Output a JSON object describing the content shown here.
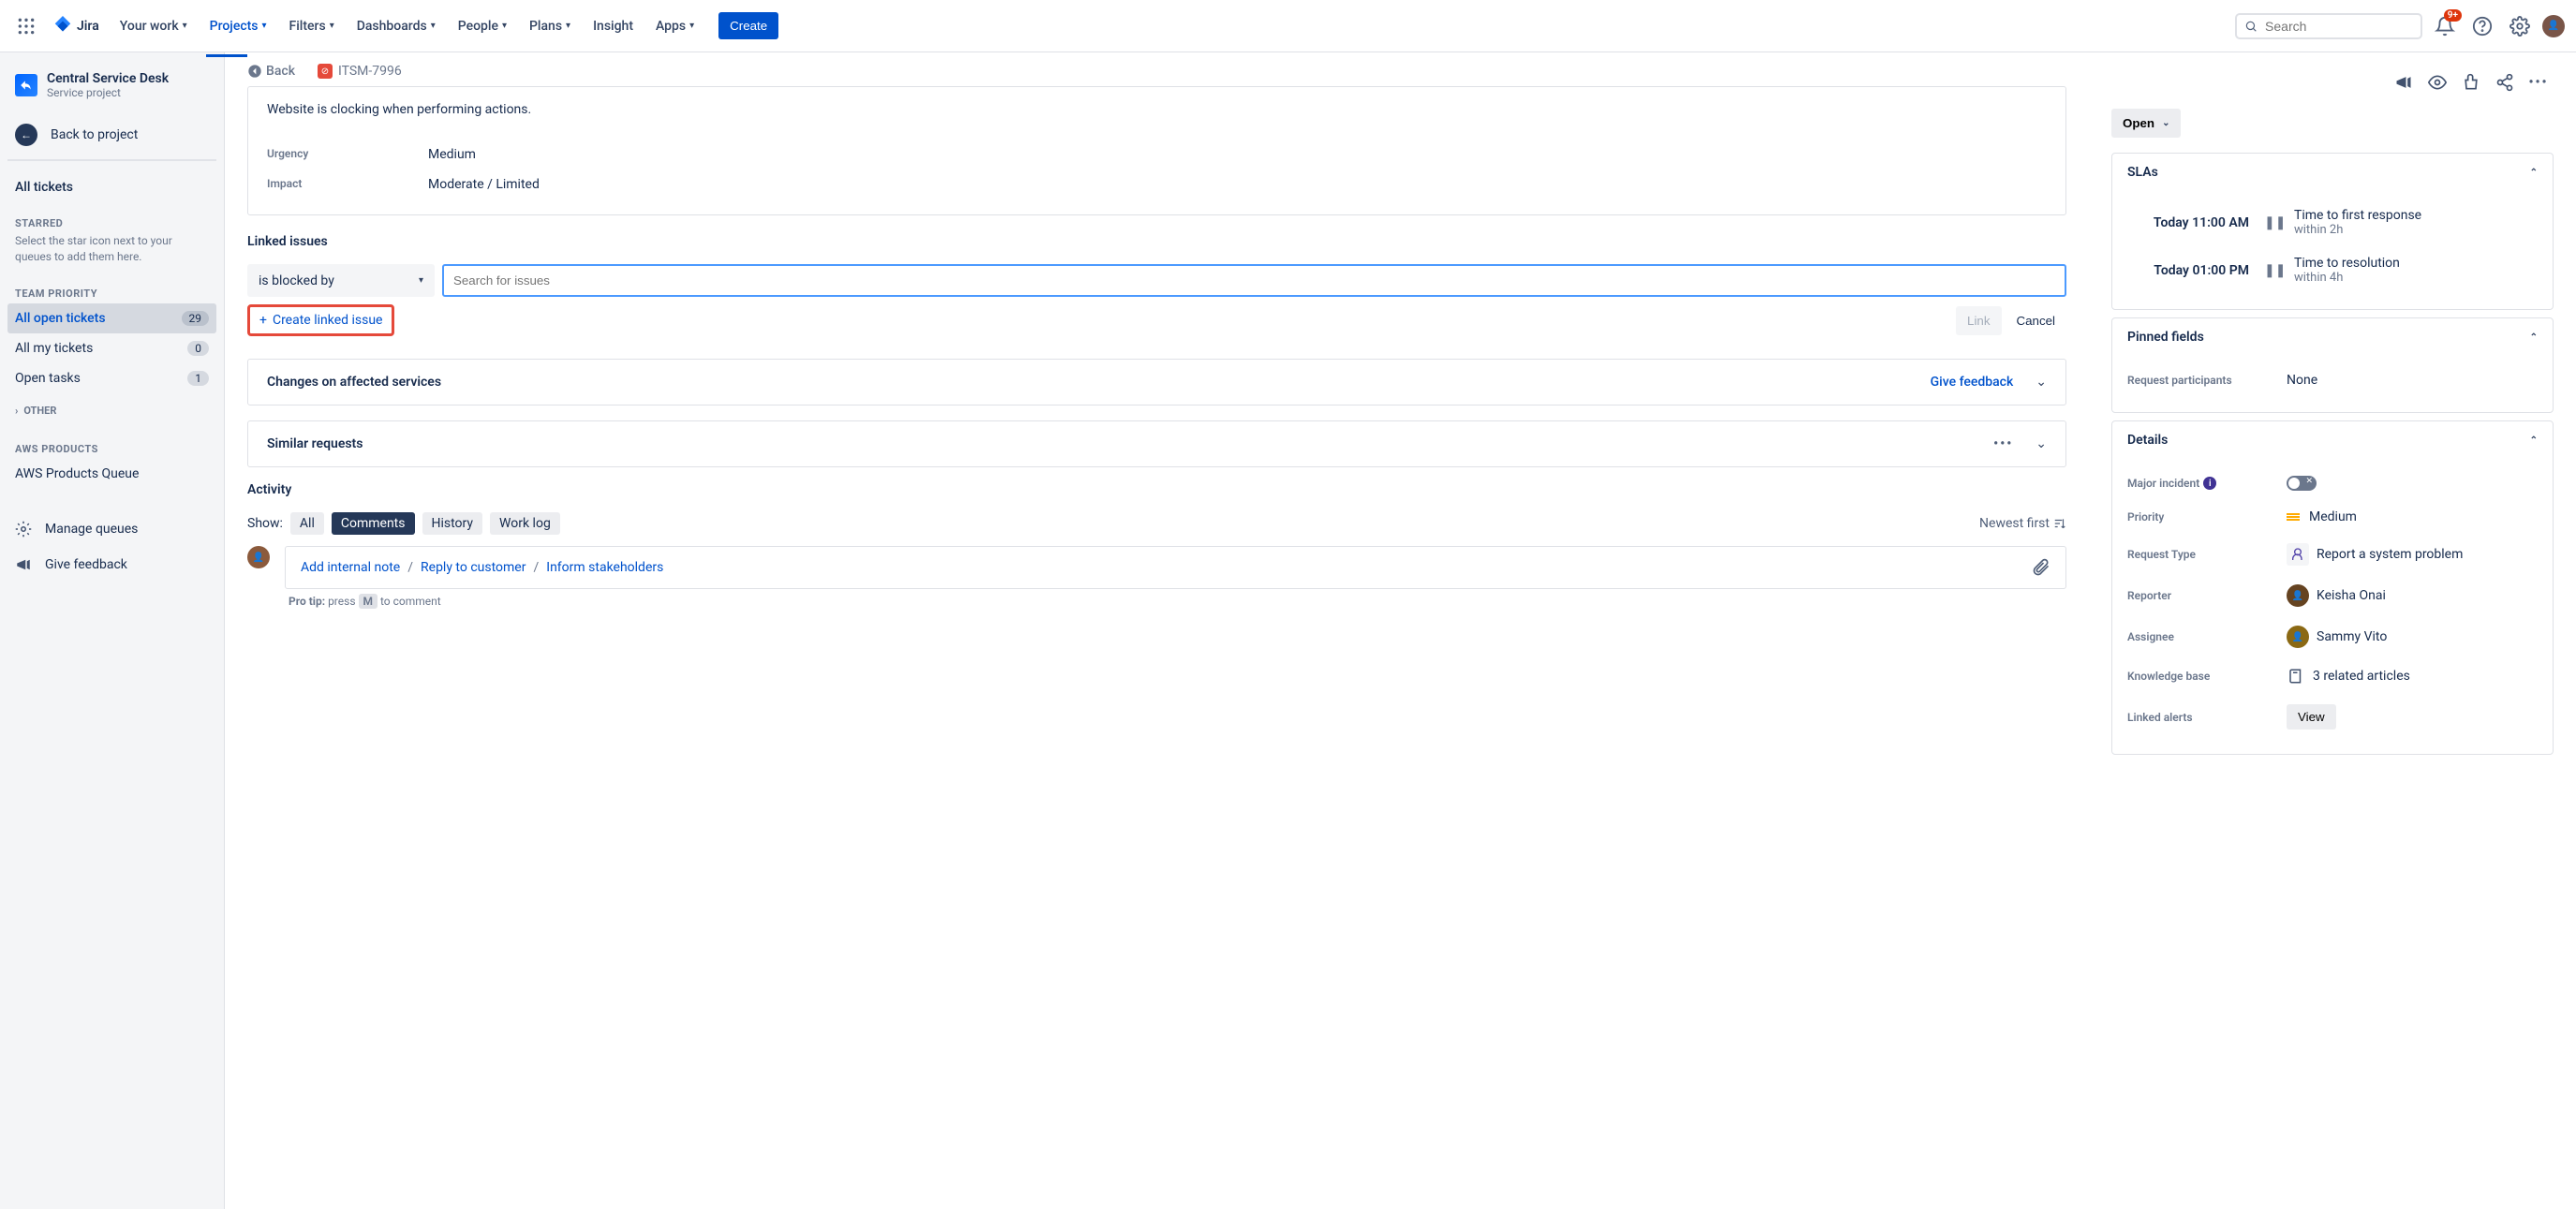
{
  "topnav": {
    "logo": "Jira",
    "items": [
      "Your work",
      "Projects",
      "Filters",
      "Dashboards",
      "People",
      "Plans",
      "Insight",
      "Apps"
    ],
    "activeIndex": 1,
    "create": "Create",
    "searchPlaceholder": "Search",
    "notifBadge": "9+"
  },
  "sidebar": {
    "projectName": "Central Service Desk",
    "projectType": "Service project",
    "back": "Back to project",
    "allTickets": "All tickets",
    "headings": {
      "starred": "STARRED",
      "teamPriority": "TEAM PRIORITY",
      "other": "OTHER",
      "aws": "AWS PRODUCTS"
    },
    "starredNote": "Select the star icon next to your queues to add them here.",
    "queues": [
      {
        "label": "All open tickets",
        "count": "29"
      },
      {
        "label": "All my tickets",
        "count": "0"
      },
      {
        "label": "Open tasks",
        "count": "1"
      }
    ],
    "awsQueue": "AWS Products Queue",
    "manage": "Manage queues",
    "feedback": "Give feedback"
  },
  "crumb": {
    "back": "Back",
    "key": "ITSM-7996"
  },
  "description": "Website is clocking when performing actions.",
  "fields": {
    "urgency": {
      "label": "Urgency",
      "value": "Medium"
    },
    "impact": {
      "label": "Impact",
      "value": "Moderate / Limited"
    }
  },
  "linked": {
    "title": "Linked issues",
    "relation": "is blocked by",
    "searchPlaceholder": "Search for issues",
    "create": "Create linked issue",
    "link": "Link",
    "cancel": "Cancel"
  },
  "affected": {
    "title": "Changes on affected services",
    "feedback": "Give feedback"
  },
  "similar": {
    "title": "Similar requests"
  },
  "activity": {
    "title": "Activity",
    "show": "Show:",
    "tabs": [
      "All",
      "Comments",
      "History",
      "Work log"
    ],
    "activeTab": 1,
    "sort": "Newest first",
    "actions": [
      "Add internal note",
      "Reply to customer",
      "Inform stakeholders"
    ],
    "protipLabel": "Pro tip:",
    "protipPress": "press",
    "protipKey": "M",
    "protipRest": "to comment"
  },
  "right": {
    "status": "Open",
    "slaTitle": "SLAs",
    "slas": [
      {
        "time": "Today 11:00 AM",
        "label": "Time to first response",
        "sub": "within 2h"
      },
      {
        "time": "Today 01:00 PM",
        "label": "Time to resolution",
        "sub": "within 4h"
      }
    ],
    "pinnedTitle": "Pinned fields",
    "pinned": {
      "label": "Request participants",
      "value": "None"
    },
    "detailsTitle": "Details",
    "details": {
      "majorIncident": "Major incident",
      "priority": {
        "label": "Priority",
        "value": "Medium"
      },
      "requestType": {
        "label": "Request Type",
        "value": "Report a system problem"
      },
      "reporter": {
        "label": "Reporter",
        "value": "Keisha Onai"
      },
      "assignee": {
        "label": "Assignee",
        "value": "Sammy Vito"
      },
      "kb": {
        "label": "Knowledge base",
        "value": "3 related articles"
      },
      "linkedAlerts": {
        "label": "Linked alerts",
        "value": "View"
      }
    }
  }
}
